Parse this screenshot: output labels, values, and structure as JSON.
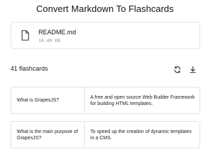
{
  "header": {
    "title": "Convert Markdown To Flashcards"
  },
  "file": {
    "name": "README.md",
    "size": "10.40 KB",
    "icon": "file-icon"
  },
  "toolbar": {
    "count_label": "41 flashcards",
    "refresh_icon": "refresh-icon",
    "download_icon": "download-icon"
  },
  "flashcards": [
    {
      "question": "What is GrapesJS?",
      "answer": "A free and open source Web Builder Framework for building HTML templates."
    },
    {
      "question": "What is the main purpose of GrapesJS?",
      "answer": "To speed up the creation of dynamic templates in a CMS."
    }
  ],
  "colors": {
    "border": "#e3e3e3",
    "text": "#111111",
    "muted": "#8a8a8a"
  }
}
